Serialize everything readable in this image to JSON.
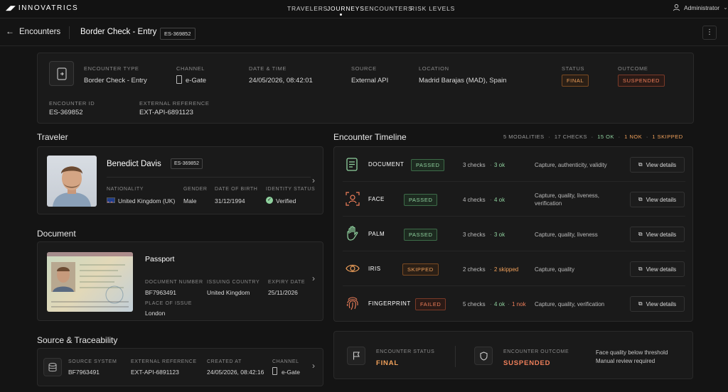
{
  "brand": "INNOVATRICS",
  "nav": {
    "items": [
      "TRAVELERS",
      "JOURNEYS",
      "ENCOUNTERS",
      "RISK LEVELS"
    ],
    "active_index": 1
  },
  "user": {
    "name": "Administrator"
  },
  "header": {
    "back_label": "Encounters",
    "title": "Border Check - Entry",
    "id_badge": "ES-369852"
  },
  "summary": {
    "encounter_type_label": "ENCOUNTER TYPE",
    "encounter_type": "Border Check - Entry",
    "channel_label": "CHANNEL",
    "channel": "e-Gate",
    "datetime_label": "DATE & TIME",
    "datetime": "24/05/2026, 08:42:01",
    "source_label": "SOURCE",
    "source": "External API",
    "location_label": "LOCATION",
    "location": "Madrid Barajas (MAD), Spain",
    "status_label": "STATUS",
    "status": "FINAL",
    "outcome_label": "OUTCOME",
    "outcome": "SUSPENDED",
    "encounter_id_label": "ENCOUNTER ID",
    "encounter_id": "ES-369852",
    "ext_ref_label": "EXTERNAL REFERENCE",
    "ext_ref": "EXT-API-6891123"
  },
  "traveler": {
    "section_title": "Traveler",
    "name": "Benedict Davis",
    "id_badge": "ES-369852",
    "nationality_label": "NATIONALITY",
    "nationality": "United Kingdom (UK)",
    "gender_label": "GENDER",
    "gender": "Male",
    "dob_label": "DATE OF BIRTH",
    "dob": "31/12/1994",
    "identity_status_label": "IDENTITY STATUS",
    "identity_status": "Verified"
  },
  "document": {
    "section_title": "Document",
    "type": "Passport",
    "number_label": "DOCUMENT NUMBER",
    "number": "BF7963491",
    "issuing_country_label": "ISSUING COUNTRY",
    "issuing_country": "United Kingdom",
    "expiry_label": "EXPIRY DATE",
    "expiry": "25/11/2026",
    "place_label": "PLACE OF ISSUE",
    "place": "London"
  },
  "trace": {
    "section_title": "Source & Traceability",
    "system_label": "SOURCE SYSTEM",
    "system": "BF7963491",
    "ext_ref_label": "EXTERNAL REFERENCE",
    "ext_ref": "EXT-API-6891123",
    "created_label": "CREATED AT",
    "created": "24/05/2026, 08:42:16",
    "channel_label": "CHANNEL",
    "channel": "e-Gate"
  },
  "timeline": {
    "section_title": "Encounter Timeline",
    "stat_modalities": "5 MODALITIES",
    "stat_checks": "17 CHECKS",
    "stat_ok": "15 OK",
    "stat_nok": "1 NOK",
    "stat_skipped": "1 SKIPPED",
    "view_label": "View details",
    "rows": [
      {
        "name": "DOCUMENT",
        "status": "PASSED",
        "checks": "3 checks",
        "detail": "3 ok",
        "desc": "Capture, authenticity, validity",
        "desc2": ""
      },
      {
        "name": "FACE",
        "status": "PASSED",
        "checks": "4 checks",
        "detail": "4 ok",
        "desc": "Capture, quality, liveness,",
        "desc2": "verification"
      },
      {
        "name": "PALM",
        "status": "PASSED",
        "checks": "3 checks",
        "detail": "3 ok",
        "desc": "Capture, quality, liveness",
        "desc2": ""
      },
      {
        "name": "IRIS",
        "status": "SKIPPED",
        "checks": "2 checks",
        "detail": "2 skipped",
        "desc": "Capture, quality",
        "desc2": ""
      },
      {
        "name": "FINGERPRINT",
        "status": "FAILED",
        "checks": "5 checks",
        "detail": "4 ok",
        "detail2": "1 nok",
        "desc": "Capture, quality, verification",
        "desc2": ""
      }
    ]
  },
  "footer": {
    "status_label": "ENCOUNTER STATUS",
    "status": "FINAL",
    "outcome_label": "ENCOUNTER OUTCOME",
    "outcome": "SUSPENDED",
    "note1": "Face quality below threshold",
    "note2": "Manual review required"
  },
  "colors": {
    "accent_orange": "#f0a05a",
    "ok_green": "#8fd19e",
    "nok_red": "#ef7f5a"
  }
}
